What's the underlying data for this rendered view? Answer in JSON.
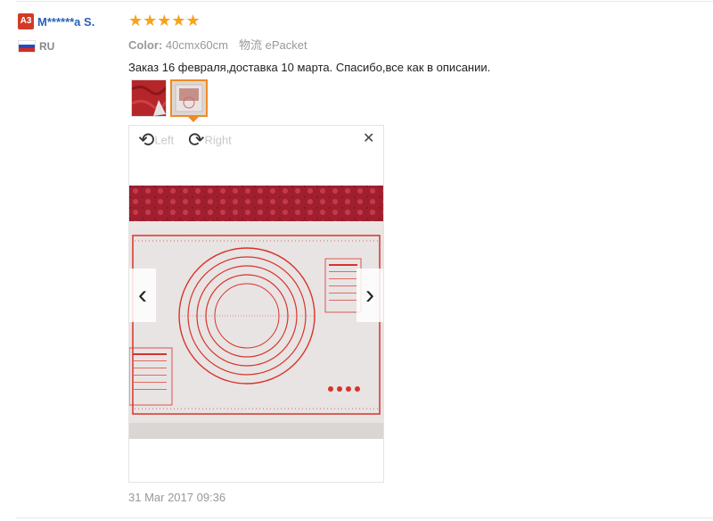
{
  "reviewer": {
    "avatar_badge": "A3",
    "name": "M******a S.",
    "country": "RU"
  },
  "rating": {
    "stars": "★★★★★",
    "value": 5,
    "max": 5
  },
  "order_meta": {
    "color_label": "Color:",
    "color_value": "40cmx60cm",
    "shipping_label": "物流",
    "shipping_value": "ePacket"
  },
  "review": {
    "text": "Заказ 16 февраля,доставка 10 марта. Спасибо,все как в описании."
  },
  "viewer": {
    "rotate_left": {
      "glyph": "⟲",
      "label": "Left"
    },
    "rotate_right": {
      "glyph": "⟳",
      "label": "Right"
    },
    "close": "✕",
    "prev": "‹",
    "next": "›"
  },
  "date": "31 Mar 2017 09:36",
  "colors": {
    "accent": "#f08a24",
    "name_link": "#2c61b8",
    "star": "#f7a21b",
    "badge": "#d33a26",
    "mat_red": "#d8332b"
  }
}
